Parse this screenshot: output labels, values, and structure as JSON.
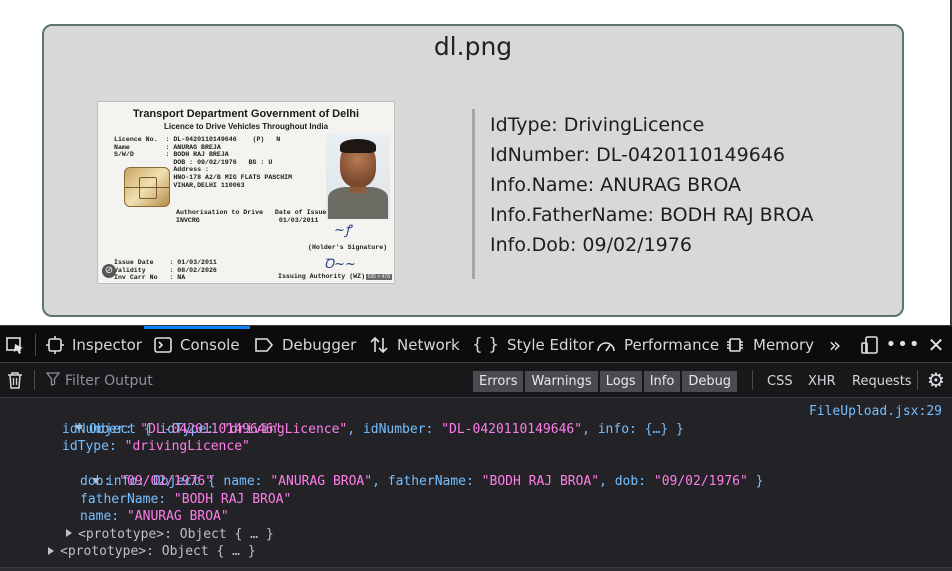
{
  "page": {
    "card_title": "dl.png",
    "fields": [
      "IdType: DrivingLicence",
      "IdNumber: DL-0420110149646",
      "Info.Name: ANURAG BROA",
      "Info.FatherName: BODH RAJ BROA",
      "Info.Dob: 09/02/1976"
    ]
  },
  "licence": {
    "heading": "Transport Department Government of Delhi",
    "subheading": "Licence to Drive Vehicles Throughout India",
    "details": "Licence No.  : DL-0420110149646    (P)   N\nName         : ANURAG BREJA\nS/W/D        : BODH RAJ BREJA\n               DOB : 09/02/1976   BG : U\n               Address :\n               HNO-178 A2/B MIG FLATS PASCHIM\n               VIHAR,DELHI 110063",
    "authorisation": "Authorisation to Drive   Date of Issue\nINVCRG                    01/03/2011",
    "holder_signature": "(Holder's Signature)",
    "validity": "Issue Date    : 01/03/2011\nValidity      : 08/02/2026\nInv Carr No   : NA",
    "issuing_authority": "Issuing Authority (WZ)",
    "dims": "695 × 478"
  },
  "devtools": {
    "tabs": [
      {
        "label": "Inspector",
        "icon": "inspector-icon"
      },
      {
        "label": "Console",
        "icon": "console-icon",
        "active": true
      },
      {
        "label": "Debugger",
        "icon": "debugger-icon"
      },
      {
        "label": "Network",
        "icon": "network-icon"
      },
      {
        "label": "Style Editor",
        "icon": "style-editor-icon"
      },
      {
        "label": "Performance",
        "icon": "performance-icon"
      },
      {
        "label": "Memory",
        "icon": "memory-icon"
      }
    ],
    "filter_placeholder": "Filter Output",
    "levels": [
      "Errors",
      "Warnings",
      "Logs",
      "Info",
      "Debug"
    ],
    "requests": [
      "CSS",
      "XHR",
      "Requests"
    ],
    "colors": {
      "accent": "#0a84ff",
      "key": "#75bfff",
      "string": "#ff7de9",
      "background": "#232327"
    }
  },
  "console": {
    "source": "FileUpload.jsx:29",
    "lines": {
      "l1_pre": "Object { idType: ",
      "l1_v1": "\"drivingLicence\"",
      "l1_mid": ", idNumber: ",
      "l1_v2": "\"DL-0420110149646\"",
      "l1_end": ", info: {…} }",
      "l2_key": "idNumber: ",
      "l2_val": "\"DL-0420110149646\"",
      "l3_key": "idType: ",
      "l3_val": "\"drivingLicence\"",
      "l4_pre": "info: Object { name: ",
      "l4_v1": "\"ANURAG BROA\"",
      "l4_mid1": ", fatherName: ",
      "l4_v2": "\"BODH RAJ BROA\"",
      "l4_mid2": ", dob: ",
      "l4_v3": "\"09/02/1976\"",
      "l4_end": " }",
      "l5_key": "dob: ",
      "l5_val": "\"09/02/1976\"",
      "l6_key": "fatherName: ",
      "l6_val": "\"BODH RAJ BROA\"",
      "l7_key": "name: ",
      "l7_val": "\"ANURAG BROA\"",
      "l8": "<prototype>: Object { … }",
      "l9": "<prototype>: Object { … }"
    }
  }
}
